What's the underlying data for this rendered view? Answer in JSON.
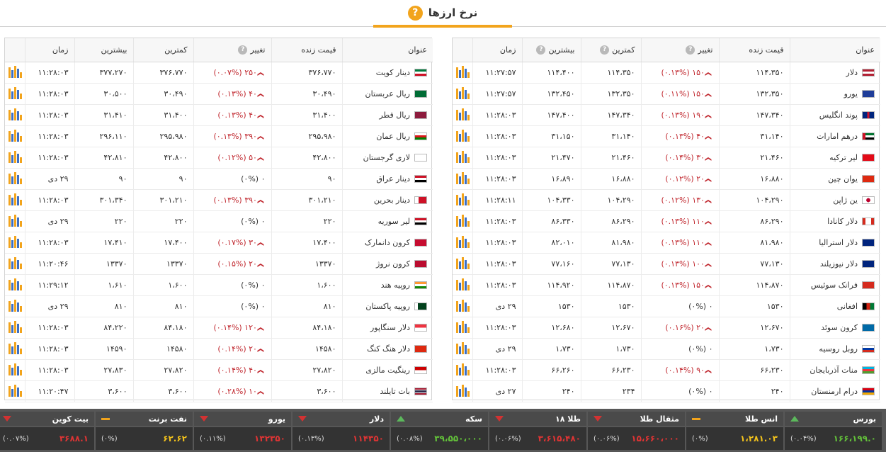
{
  "header": {
    "title": "نرخ ارزها",
    "help": "?"
  },
  "columns": {
    "title": "عنوان",
    "price": "قیمت زنده",
    "change": "تغییر",
    "low": "کمترین",
    "high": "بیشترین",
    "time": "زمان",
    "help": "?"
  },
  "right_table": [
    {
      "title": "دلار",
      "price": "۱۱۴،۳۵۰",
      "change": "۱۵۰ (۰.۱۳%)",
      "low": "۱۱۴،۳۵۰",
      "high": "۱۱۴،۴۰۰",
      "time": "۱۱:۲۷:۵۷",
      "dir": "down",
      "flag": "us"
    },
    {
      "title": "یورو",
      "price": "۱۳۲،۳۵۰",
      "change": "۱۵۰ (۰.۱۱%)",
      "low": "۱۳۲،۳۵۰",
      "high": "۱۳۲،۴۵۰",
      "time": "۱۱:۲۷:۵۷",
      "dir": "down",
      "flag": "eu"
    },
    {
      "title": "پوند انگلیس",
      "price": "۱۴۷،۳۴۰",
      "change": "۱۹۰ (۰.۱۳%)",
      "low": "۱۴۷،۳۴۰",
      "high": "۱۴۷،۴۰۰",
      "time": "۱۱:۲۸:۰۳",
      "dir": "down",
      "flag": "gb"
    },
    {
      "title": "درهم امارات",
      "price": "۳۱،۱۴۰",
      "change": "۴۰ (۰.۱۳%)",
      "low": "۳۱،۱۴۰",
      "high": "۳۱،۱۵۰",
      "time": "۱۱:۲۸:۰۳",
      "dir": "down",
      "flag": "ae"
    },
    {
      "title": "لیر ترکیه",
      "price": "۲۱،۴۶۰",
      "change": "۳۰ (۰.۱۴%)",
      "low": "۲۱،۴۶۰",
      "high": "۲۱،۴۷۰",
      "time": "۱۱:۲۸:۰۳",
      "dir": "down",
      "flag": "tr"
    },
    {
      "title": "یوان چین",
      "price": "۱۶،۸۸۰",
      "change": "۲۰ (۰.۱۲%)",
      "low": "۱۶،۸۸۰",
      "high": "۱۶،۸۹۰",
      "time": "۱۱:۲۸:۰۳",
      "dir": "down",
      "flag": "cn"
    },
    {
      "title": "ین ژاپن",
      "price": "۱۰۴،۲۹۰",
      "change": "۱۳۰ (۰.۱۲%)",
      "low": "۱۰۴،۲۹۰",
      "high": "۱۰۴،۳۳۰",
      "time": "۱۱:۲۸:۱۱",
      "dir": "down",
      "flag": "jp"
    },
    {
      "title": "دلار کانادا",
      "price": "۸۶،۲۹۰",
      "change": "۱۱۰ (۰.۱۳%)",
      "low": "۸۶،۲۹۰",
      "high": "۸۶،۳۳۰",
      "time": "۱۱:۲۸:۰۳",
      "dir": "down",
      "flag": "ca"
    },
    {
      "title": "دلار استرالیا",
      "price": "۸۱،۹۸۰",
      "change": "۱۱۰ (۰.۱۳%)",
      "low": "۸۱،۹۸۰",
      "high": "۸۲،۰۱۰",
      "time": "۱۱:۲۸:۰۳",
      "dir": "down",
      "flag": "au"
    },
    {
      "title": "دلار نیوزیلند",
      "price": "۷۷،۱۳۰",
      "change": "۱۰۰ (۰.۱۳%)",
      "low": "۷۷،۱۳۰",
      "high": "۷۷،۱۶۰",
      "time": "۱۱:۲۸:۰۳",
      "dir": "down",
      "flag": "nz"
    },
    {
      "title": "فرانک سوئیس",
      "price": "۱۱۴،۸۷۰",
      "change": "۱۵۰ (۰.۱۳%)",
      "low": "۱۱۴،۸۷۰",
      "high": "۱۱۴،۹۲۰",
      "time": "۱۱:۲۸:۰۳",
      "dir": "down",
      "flag": "ch"
    },
    {
      "title": "افغانی",
      "price": "۱۵۳۰",
      "change": "۰ (۰%)",
      "low": "۱۵۳۰",
      "high": "۱۵۳۰",
      "time": "۲۹ دی",
      "dir": "none",
      "flag": "af"
    },
    {
      "title": "کرون سوئد",
      "price": "۱۲،۶۷۰",
      "change": "۲۰ (۰.۱۶%)",
      "low": "۱۲،۶۷۰",
      "high": "۱۲،۶۸۰",
      "time": "۱۱:۲۸:۰۳",
      "dir": "down",
      "flag": "se"
    },
    {
      "title": "روبل روسیه",
      "price": "۱،۷۳۰",
      "change": "۰ (۰%)",
      "low": "۱،۷۳۰",
      "high": "۱،۷۳۰",
      "time": "۲۹ دی",
      "dir": "none",
      "flag": "ru"
    },
    {
      "title": "منات آذربایجان",
      "price": "۶۶،۲۳۰",
      "change": "۹۰ (۰.۱۴%)",
      "low": "۶۶،۲۳۰",
      "high": "۶۶،۲۶۰",
      "time": "۱۱:۲۸:۰۳",
      "dir": "down",
      "flag": "az"
    },
    {
      "title": "درام ارمنستان",
      "price": "۲۴۰",
      "change": "۰ (۰%)",
      "low": "۲۳۴",
      "high": "۲۴۰",
      "time": "۲۷ دی",
      "dir": "none",
      "flag": "am"
    }
  ],
  "left_table": [
    {
      "title": "دینار کویت",
      "price": "۳۷۶،۷۷۰",
      "change": "۲۵۰ (۰.۰۷%)",
      "low": "۳۷۶،۷۷۰",
      "high": "۳۷۷،۲۷۰",
      "time": "۱۱:۲۸:۰۳",
      "dir": "down",
      "flag": "kw"
    },
    {
      "title": "ریال عربستان",
      "price": "۳۰،۴۹۰",
      "change": "۴۰ (۰.۱۳%)",
      "low": "۳۰،۴۹۰",
      "high": "۳۰،۵۰۰",
      "time": "۱۱:۲۸:۰۳",
      "dir": "down",
      "flag": "sa"
    },
    {
      "title": "ریال قطر",
      "price": "۳۱،۴۰۰",
      "change": "۴۰ (۰.۱۳%)",
      "low": "۳۱،۴۰۰",
      "high": "۳۱،۴۱۰",
      "time": "۱۱:۲۸:۰۳",
      "dir": "down",
      "flag": "qa"
    },
    {
      "title": "ریال عمان",
      "price": "۲۹۵،۹۸۰",
      "change": "۳۹۰ (۰.۱۳%)",
      "low": "۲۹۵،۹۸۰",
      "high": "۲۹۶،۱۱۰",
      "time": "۱۱:۲۸:۰۳",
      "dir": "down",
      "flag": "om"
    },
    {
      "title": "لاری گرجستان",
      "price": "۴۲،۸۰۰",
      "change": "۵۰ (۰.۱۲%)",
      "low": "۴۲،۸۰۰",
      "high": "۴۲،۸۱۰",
      "time": "۱۱:۲۸:۰۳",
      "dir": "down",
      "flag": "ge"
    },
    {
      "title": "دینار عراق",
      "price": "۹۰",
      "change": "۰ (۰%)",
      "low": "۹۰",
      "high": "۹۰",
      "time": "۲۹ دی",
      "dir": "none",
      "flag": "iq"
    },
    {
      "title": "دینار بحرین",
      "price": "۳۰۱،۲۱۰",
      "change": "۳۹۰ (۰.۱۳%)",
      "low": "۳۰۱،۲۱۰",
      "high": "۳۰۱،۳۴۰",
      "time": "۱۱:۲۸:۰۳",
      "dir": "down",
      "flag": "bh"
    },
    {
      "title": "لیر سوریه",
      "price": "۲۲۰",
      "change": "۰ (۰%)",
      "low": "۲۲۰",
      "high": "۲۲۰",
      "time": "۲۹ دی",
      "dir": "none",
      "flag": "sy"
    },
    {
      "title": "کرون دانمارک",
      "price": "۱۷،۴۰۰",
      "change": "۳۰ (۰.۱۷%)",
      "low": "۱۷،۴۰۰",
      "high": "۱۷،۴۱۰",
      "time": "۱۱:۲۸:۰۳",
      "dir": "down",
      "flag": "dk"
    },
    {
      "title": "کرون نروژ",
      "price": "۱۳۳۷۰",
      "change": "۲۰ (۰.۱۵%)",
      "low": "۱۳۳۷۰",
      "high": "۱۳۳۷۰",
      "time": "۱۱:۲۰:۴۶",
      "dir": "down",
      "flag": "no"
    },
    {
      "title": "روپیه هند",
      "price": "۱،۶۰۰",
      "change": "۰ (۰%)",
      "low": "۱،۶۰۰",
      "high": "۱،۶۱۰",
      "time": "۱۱:۲۹:۱۲",
      "dir": "none",
      "flag": "in"
    },
    {
      "title": "روپیه پاکستان",
      "price": "۸۱۰",
      "change": "۰ (۰%)",
      "low": "۸۱۰",
      "high": "۸۱۰",
      "time": "۲۹ دی",
      "dir": "none",
      "flag": "pk"
    },
    {
      "title": "دلار سنگاپور",
      "price": "۸۴،۱۸۰",
      "change": "۱۲۰ (۰.۱۴%)",
      "low": "۸۴،۱۸۰",
      "high": "۸۴،۲۲۰",
      "time": "۱۱:۲۸:۰۳",
      "dir": "down",
      "flag": "sg"
    },
    {
      "title": "دلار هنگ کنگ",
      "price": "۱۴۵۸۰",
      "change": "۲۰ (۰.۱۴%)",
      "low": "۱۴۵۸۰",
      "high": "۱۴۵۹۰",
      "time": "۱۱:۲۸:۰۳",
      "dir": "down",
      "flag": "hk"
    },
    {
      "title": "رینگیت مالزی",
      "price": "۲۷،۸۲۰",
      "change": "۴۰ (۰.۱۴%)",
      "low": "۲۷،۸۲۰",
      "high": "۲۷،۸۳۰",
      "time": "۱۱:۲۸:۰۳",
      "dir": "down",
      "flag": "my"
    },
    {
      "title": "بات تایلند",
      "price": "۳،۶۰۰",
      "change": "۱۰ (۰.۲۸%)",
      "low": "۳،۶۰۰",
      "high": "۳،۶۰۰",
      "time": "۱۱:۲۰:۴۷",
      "dir": "down",
      "flag": "th"
    }
  ],
  "ticker": [
    {
      "name": "بورس",
      "value": "۱۶۶،۱۹۹.۰",
      "pct": "(۰.۰۴%)",
      "trend": "up",
      "color": "green"
    },
    {
      "name": "انس طلا",
      "value": "۱،۲۸۱.۰۳",
      "pct": "(۰%)",
      "trend": "flat",
      "color": "yellow"
    },
    {
      "name": "مثقال طلا",
      "value": "۱۵،۶۶۰،۰۰۰",
      "pct": "(۰.۰۶%)",
      "trend": "down",
      "color": "red"
    },
    {
      "name": "طلا ۱۸",
      "value": "۳،۶۱۵،۴۸۰",
      "pct": "(۰.۰۶%)",
      "trend": "down",
      "color": "red"
    },
    {
      "name": "سکه",
      "value": "۳۹،۵۵۰،۰۰۰",
      "pct": "(۰.۰۸%)",
      "trend": "up",
      "color": "green"
    },
    {
      "name": "دلار",
      "value": "۱۱۴۳۵۰",
      "pct": "(۰.۱۳%)",
      "trend": "down",
      "color": "red"
    },
    {
      "name": "یورو",
      "value": "۱۳۲۳۵۰",
      "pct": "(۰.۱۱%)",
      "trend": "down",
      "color": "red"
    },
    {
      "name": "نفت برنت",
      "value": "۶۲.۶۲",
      "pct": "(۰%)",
      "trend": "flat",
      "color": "yellow"
    },
    {
      "name": "بیت کوین",
      "value": "۳۶۸۸.۱",
      "pct": "(۰.۰۷%)",
      "trend": "down",
      "color": "red"
    }
  ],
  "colors": {
    "accent": "#f2a41c",
    "down": "#c0262d",
    "up": "#5cb85c",
    "ticker_bg": "#575757"
  }
}
